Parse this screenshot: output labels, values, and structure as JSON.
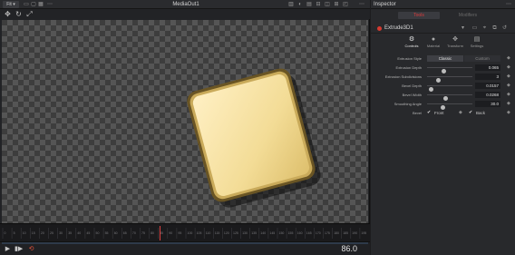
{
  "viewer": {
    "zoom_label": "Fit",
    "title": "MediaOut1",
    "current_frame": "86.0"
  },
  "timeline": {
    "ticks": [
      "0",
      "5",
      "10",
      "15",
      "20",
      "25",
      "30",
      "35",
      "40",
      "45",
      "50",
      "55",
      "60",
      "65",
      "70",
      "75",
      "80",
      "85",
      "90",
      "95",
      "100",
      "105",
      "110",
      "115",
      "120",
      "125",
      "130",
      "135",
      "140",
      "145",
      "150",
      "155",
      "160",
      "165",
      "170",
      "175",
      "180",
      "185",
      "190",
      "195"
    ],
    "playhead_frame": 86
  },
  "inspector": {
    "title": "Inspector",
    "tabs": {
      "tools": "Tools",
      "modifiers": "Modifiers"
    },
    "node_name": "Extrude3D1",
    "sub_tabs": {
      "controls": "Controls",
      "material": "Material",
      "transform": "Transform",
      "settings": "Settings"
    },
    "params": {
      "extrusion_style": {
        "label": "Extrusion Style",
        "options": [
          "Classic",
          "Custom"
        ],
        "selected": "Classic"
      },
      "extrusion_depth": {
        "label": "Extrusion Depth",
        "value": "0.065",
        "fraction": 0.35
      },
      "extrusion_subdivisions": {
        "label": "Extrusion Subdivisions",
        "value": "3",
        "fraction": 0.22
      },
      "bevel_depth": {
        "label": "Bevel Depth",
        "value": "0.0157",
        "fraction": 0.05
      },
      "bevel_width": {
        "label": "Bevel Width",
        "value": "0.0268",
        "fraction": 0.4
      },
      "smoothing_angle": {
        "label": "Smoothing Angle",
        "value": "30.0",
        "fraction": 0.33
      },
      "bevel": {
        "label": "Bevel",
        "front_label": "Front",
        "back_label": "Back",
        "front_checked": true,
        "back_checked": true
      }
    }
  },
  "colors": {
    "accent_red": "#e03c3c",
    "node_red": "#d63a30",
    "shape_face": "#f3dc96",
    "shape_edge": "#6a5524"
  }
}
